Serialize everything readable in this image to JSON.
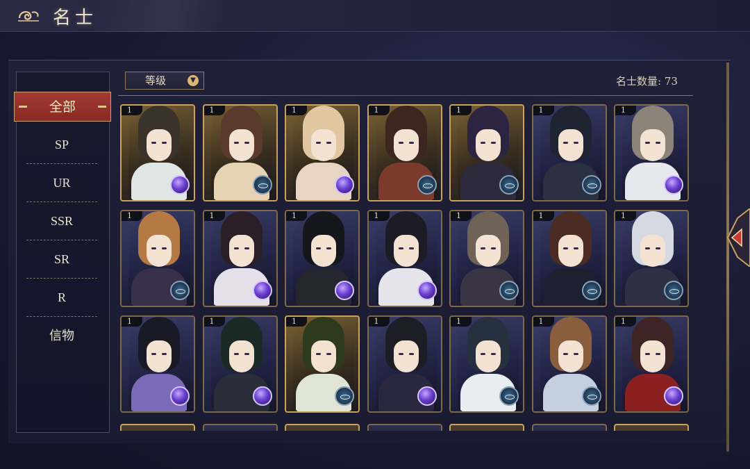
{
  "header": {
    "title": "名士",
    "emblem_icon": "cloud-emblem-icon"
  },
  "sidebar": {
    "active": "全部",
    "items": [
      "SP",
      "UR",
      "SSR",
      "SR",
      "R",
      "信物"
    ]
  },
  "filter": {
    "label": "等级",
    "icon": "chevron-down-icon"
  },
  "count": {
    "label": "名士数量: 73"
  },
  "colors": {
    "accent_red": "#a33a34",
    "gold_border": "#c9a35b",
    "panel": "#1b1c33"
  },
  "cards": [
    {
      "level": "1",
      "bg": "gold",
      "hair": "#3a332c",
      "robe": "#dfe7e4",
      "badge": "orb"
    },
    {
      "level": "1",
      "bg": "gold",
      "hair": "#5a3a2c",
      "robe": "#e6d3b3",
      "badge": "eye"
    },
    {
      "level": "1",
      "bg": "gold",
      "hair": "#e2c8a2",
      "robe": "#e8d4c2",
      "badge": "orb"
    },
    {
      "level": "1",
      "bg": "gold",
      "hair": "#3d2520",
      "robe": "#7b3a2c",
      "badge": "eye"
    },
    {
      "level": "1",
      "bg": "gold",
      "hair": "#2c2440",
      "robe": "#2e2a3e",
      "badge": "eye"
    },
    {
      "level": "1",
      "bg": "blue",
      "hair": "#1f2433",
      "robe": "#2b3042",
      "badge": "eye"
    },
    {
      "level": "1",
      "bg": "blue",
      "hair": "#8c8478",
      "robe": "#e6e8ee",
      "badge": "orb"
    },
    {
      "level": "1",
      "bg": "blue",
      "hair": "#b57a44",
      "robe": "#38304a",
      "badge": "eye"
    },
    {
      "level": "1",
      "bg": "blue",
      "hair": "#2a1f26",
      "robe": "#e6e0ea",
      "badge": "orb"
    },
    {
      "level": "1",
      "bg": "blue",
      "hair": "#15171c",
      "robe": "#26262e",
      "badge": "orb"
    },
    {
      "level": "1",
      "bg": "blue",
      "hair": "#1d1b26",
      "robe": "#e4e4ea",
      "badge": "orb"
    },
    {
      "level": "1",
      "bg": "blue",
      "hair": "#6e6356",
      "robe": "#3a3545",
      "badge": "eye"
    },
    {
      "level": "1",
      "bg": "blue",
      "hair": "#4a2c22",
      "robe": "#1d2030",
      "badge": "eye"
    },
    {
      "level": "1",
      "bg": "blue",
      "hair": "#d7d9e2",
      "robe": "#2e3044",
      "badge": "eye"
    },
    {
      "level": "1",
      "bg": "blue",
      "hair": "#1a1a26",
      "robe": "#7a6ab8",
      "badge": "orb"
    },
    {
      "level": "1",
      "bg": "blue",
      "hair": "#1c2a25",
      "robe": "#2a2e38",
      "badge": "orb"
    },
    {
      "level": "1",
      "bg": "gold",
      "hair": "#2e3a1e",
      "robe": "#dfe4d4",
      "badge": "eye"
    },
    {
      "level": "1",
      "bg": "blue",
      "hair": "#1d1d26",
      "robe": "#2a2840",
      "badge": "orb"
    },
    {
      "level": "1",
      "bg": "blue",
      "hair": "#27303f",
      "robe": "#e8edf2",
      "badge": "eye"
    },
    {
      "level": "1",
      "bg": "blue",
      "hair": "#8a5d3c",
      "robe": "#c6cfe0",
      "badge": "eye"
    },
    {
      "level": "1",
      "bg": "blue",
      "hair": "#3e2424",
      "robe": "#8a2020",
      "badge": "orb"
    }
  ]
}
